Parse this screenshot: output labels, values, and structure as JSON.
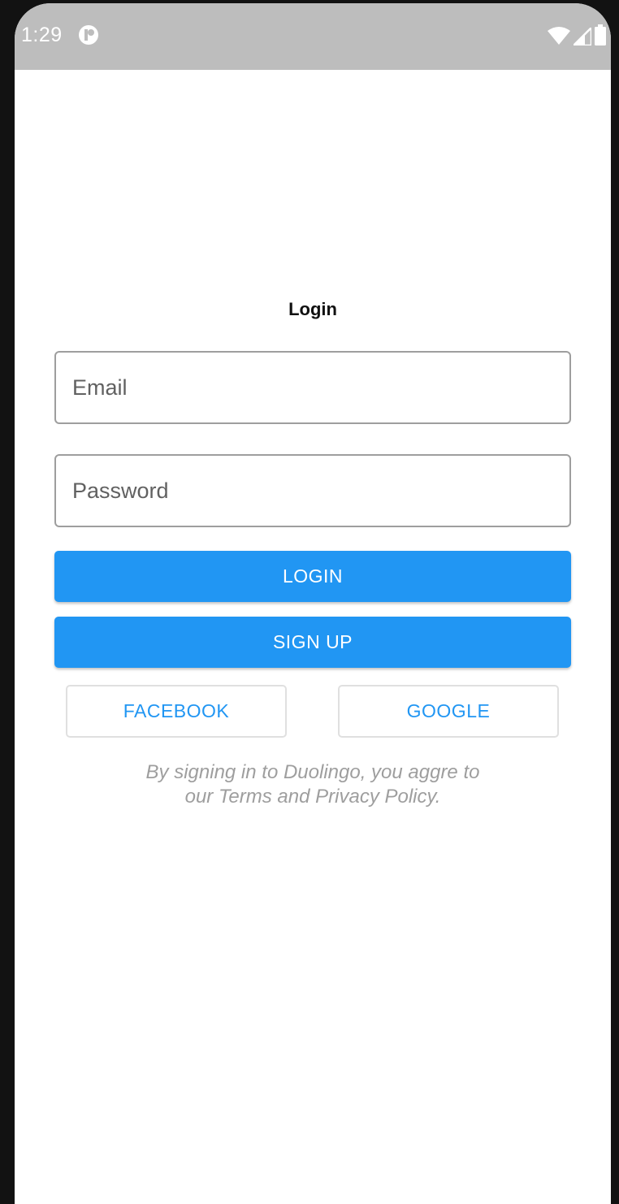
{
  "status_bar": {
    "time": "1:29",
    "icons": [
      "app-notification-icon",
      "wifi-icon",
      "signal-icon",
      "battery-icon"
    ]
  },
  "login": {
    "title": "Login",
    "email_placeholder": "Email",
    "password_placeholder": "Password",
    "login_label": "LOGIN",
    "signup_label": "SIGN UP",
    "facebook_label": "FACEBOOK",
    "google_label": "GOOGLE",
    "terms_line1": "By signing in to Duolingo, you aggre to",
    "terms_line2": "our Terms and Privacy Policy."
  },
  "colors": {
    "accent": "#2196f3",
    "status_bar": "#bdbdbd",
    "muted_text": "#9e9e9e"
  }
}
